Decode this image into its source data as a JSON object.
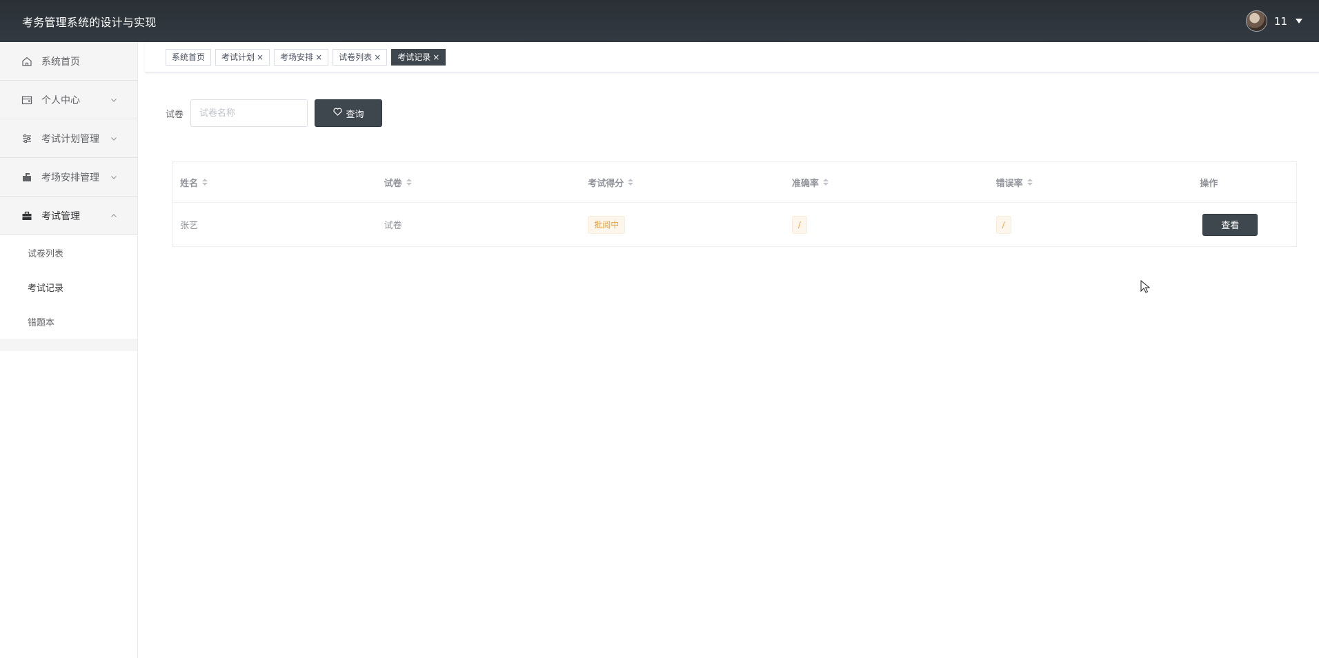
{
  "header": {
    "app_title": "考务管理系统的设计与实现",
    "user_name": "11"
  },
  "sidebar": {
    "items": [
      {
        "label": "系统首页",
        "icon": "home-icon"
      },
      {
        "label": "个人中心",
        "icon": "wallet-icon"
      },
      {
        "label": "考试计划管理",
        "icon": "sliders-icon"
      },
      {
        "label": "考场安排管理",
        "icon": "mailbox-icon"
      },
      {
        "label": "考试管理",
        "icon": "briefcase-icon"
      }
    ],
    "submenu": [
      {
        "label": "试卷列表"
      },
      {
        "label": "考试记录",
        "active": true
      },
      {
        "label": "错题本"
      }
    ]
  },
  "tags": [
    {
      "label": "系统首页",
      "closable": false
    },
    {
      "label": "考试计划",
      "closable": true
    },
    {
      "label": "考场安排",
      "closable": true
    },
    {
      "label": "试卷列表",
      "closable": true
    },
    {
      "label": "考试记录",
      "closable": true,
      "active": true
    }
  ],
  "tag_close_glyph": "×",
  "search": {
    "label": "试卷",
    "placeholder": "试卷名称",
    "value": "",
    "button_label": "查询"
  },
  "table": {
    "columns": [
      "姓名",
      "试卷",
      "考试得分",
      "准确率",
      "错误率",
      "操作"
    ],
    "rows": [
      {
        "name": "张艺",
        "paper": "试卷",
        "score": "批阅中",
        "accuracy": "/",
        "error_rate": "/",
        "action": "查看"
      }
    ]
  },
  "colors": {
    "header_bg": "#2a3036",
    "primary_button": "#3e464e",
    "warning_text": "#e6a23c",
    "warning_bg": "#fdf6ec"
  }
}
